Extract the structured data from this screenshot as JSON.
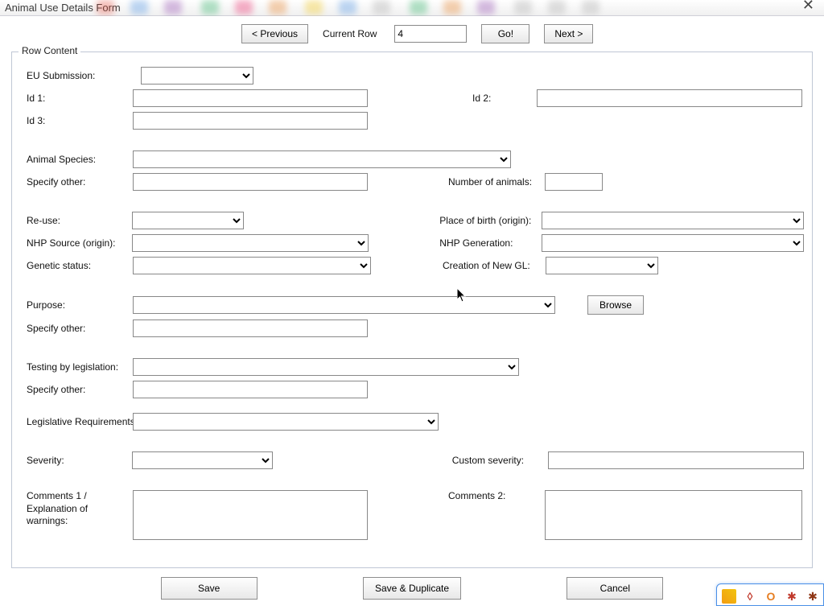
{
  "window": {
    "title": "Animal Use Details Form"
  },
  "nav": {
    "prev": "< Previous",
    "current_row_label": "Current Row",
    "current_row_value": "4",
    "go": "Go!",
    "next": "Next >"
  },
  "fieldset": {
    "legend": "Row Content"
  },
  "labels": {
    "eu_submission": "EU Submission:",
    "id1": "Id 1:",
    "id2": "Id 2:",
    "id3": "Id 3:",
    "animal_species": "Animal Species:",
    "specify_other": "Specify other:",
    "number_of_animals": "Number of animals:",
    "reuse": "Re-use:",
    "place_of_birth": "Place of birth (origin):",
    "nhp_source": "NHP Source (origin):",
    "nhp_generation": "NHP Generation:",
    "genetic_status": "Genetic status:",
    "creation_new_gl": "Creation of New GL:",
    "purpose": "Purpose:",
    "browse": "Browse",
    "testing_by_legislation": "Testing by legislation:",
    "legislative_requirements": "Legislative Requirements:",
    "severity": "Severity:",
    "custom_severity": "Custom severity:",
    "comments1": "Comments 1 / Explanation of warnings:",
    "comments2": "Comments 2:"
  },
  "values": {
    "eu_submission": "",
    "id1": "",
    "id2": "",
    "id3": "",
    "animal_species": "",
    "specify_other_species": "",
    "number_of_animals": "",
    "reuse": "",
    "place_of_birth": "",
    "nhp_source": "",
    "nhp_generation": "",
    "genetic_status": "",
    "creation_new_gl": "",
    "purpose": "",
    "specify_other_purpose": "",
    "testing_by_legislation": "",
    "specify_other_testing": "",
    "legislative_requirements": "",
    "severity": "",
    "custom_severity": "",
    "comments1": "",
    "comments2": ""
  },
  "footer": {
    "save": "Save",
    "save_duplicate": "Save & Duplicate",
    "cancel": "Cancel"
  }
}
